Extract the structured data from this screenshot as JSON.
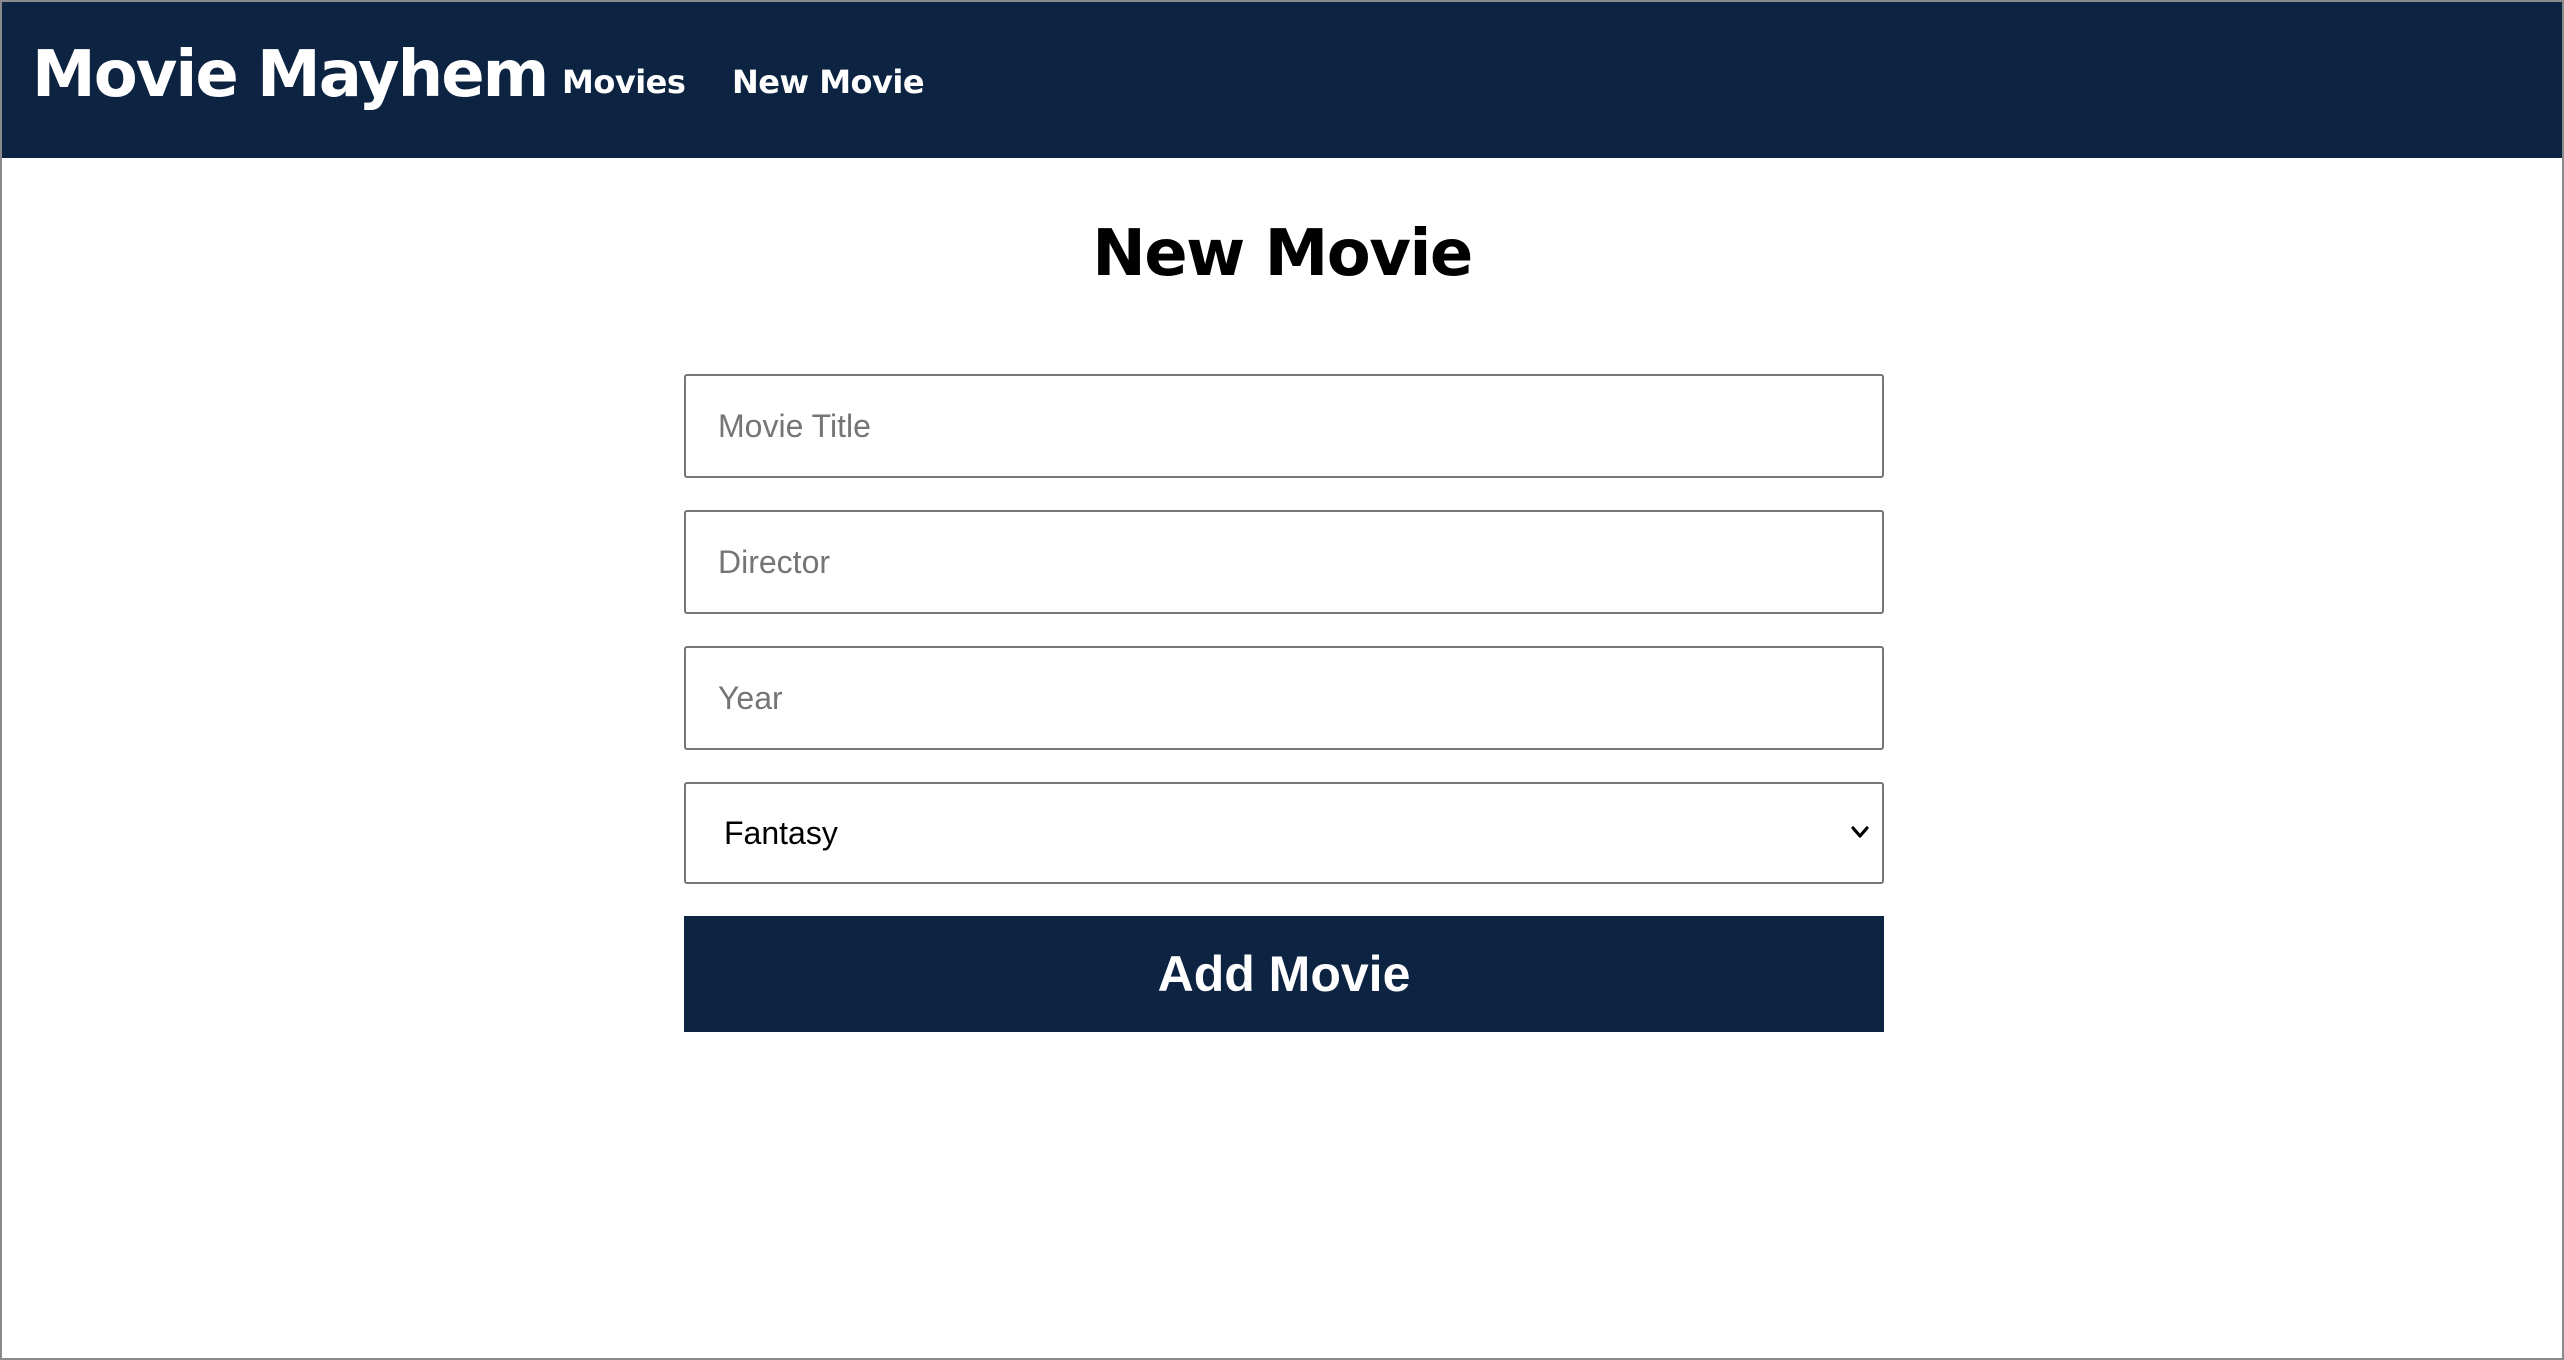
{
  "app": {
    "brand": "Movie Mayhem",
    "nav": {
      "movies_label": "Movies",
      "new_movie_label": "New Movie"
    }
  },
  "page": {
    "title": "New Movie"
  },
  "form": {
    "title_field": {
      "placeholder": "Movie Title",
      "value": ""
    },
    "director_field": {
      "placeholder": "Director",
      "value": ""
    },
    "year_field": {
      "placeholder": "Year",
      "value": ""
    },
    "genre_select": {
      "selected": "Fantasy",
      "icon": "chevron-down-icon"
    },
    "submit_label": "Add Movie"
  },
  "colors": {
    "navbar_bg": "#0c2342",
    "button_bg": "#0c2342",
    "text_on_dark": "#ffffff"
  }
}
